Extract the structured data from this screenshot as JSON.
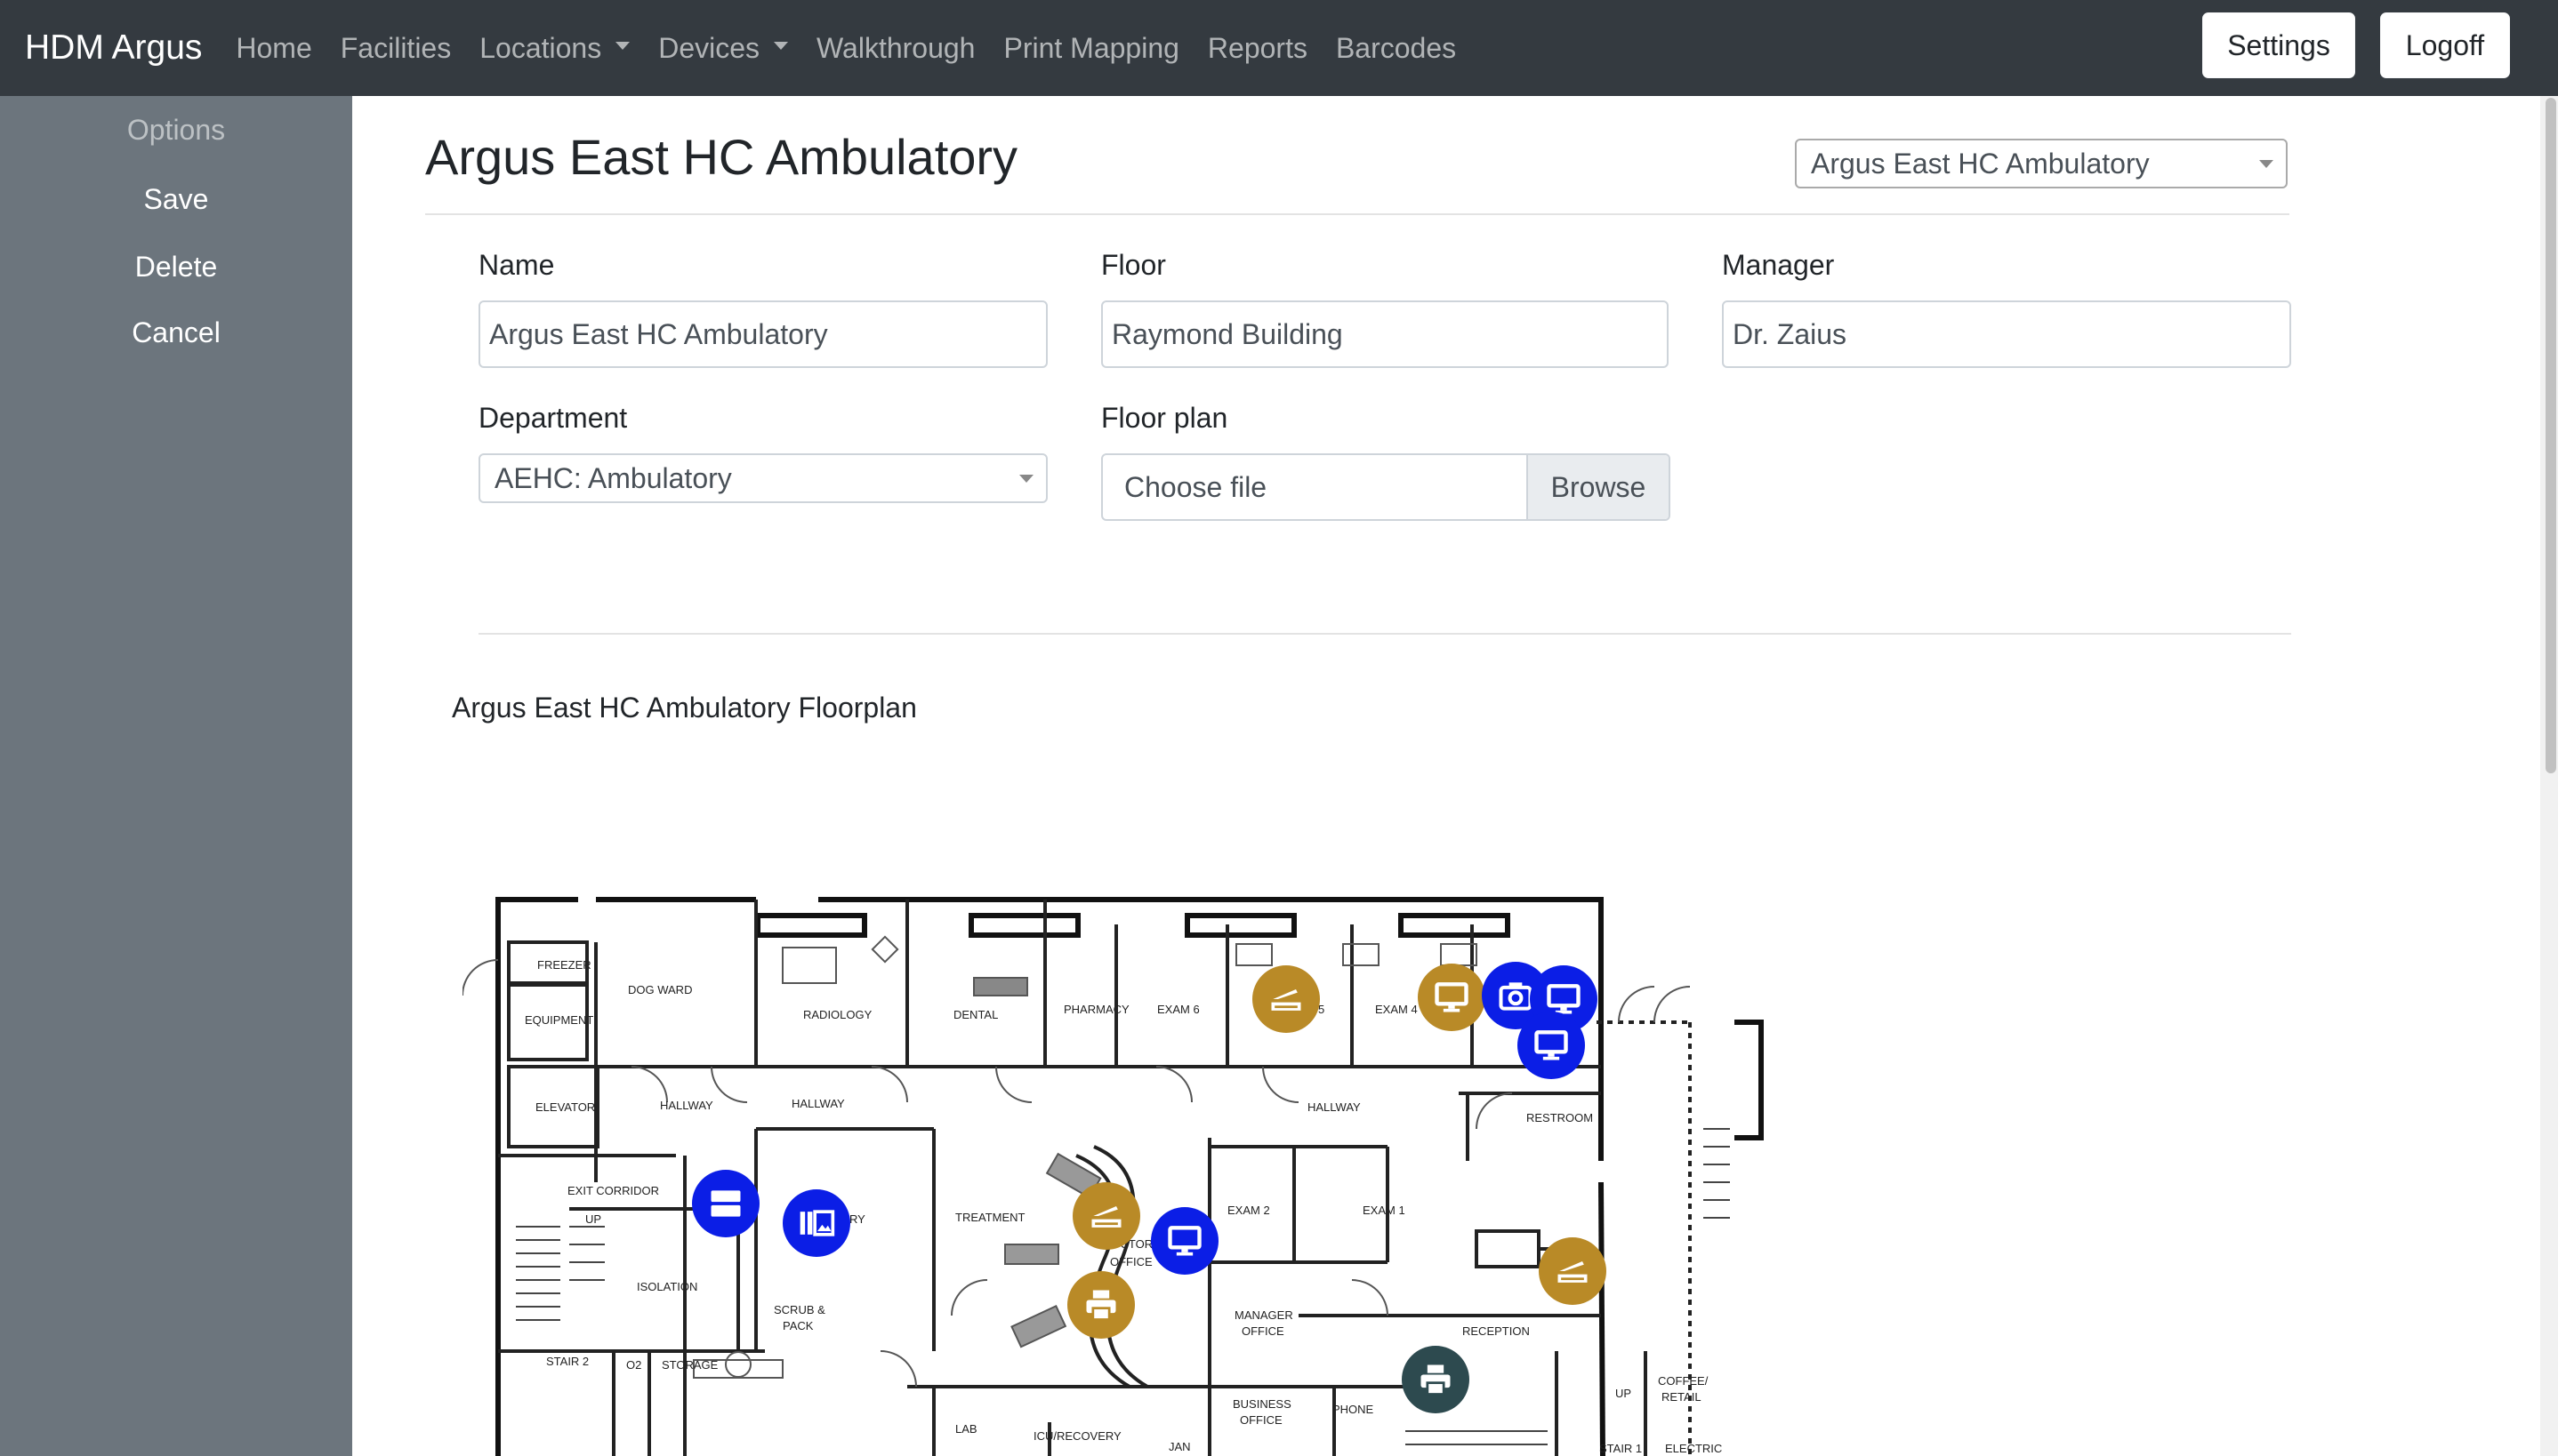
{
  "navbar": {
    "brand": "HDM Argus",
    "items": [
      {
        "label": "Home"
      },
      {
        "label": "Facilities"
      },
      {
        "label": "Locations",
        "dropdown": true
      },
      {
        "label": "Devices",
        "dropdown": true
      },
      {
        "label": "Walkthrough"
      },
      {
        "label": "Print Mapping"
      },
      {
        "label": "Reports"
      },
      {
        "label": "Barcodes"
      }
    ],
    "settings_label": "Settings",
    "logoff_label": "Logoff"
  },
  "sidebar": {
    "heading": "Options",
    "items": [
      {
        "label": "Save"
      },
      {
        "label": "Delete"
      },
      {
        "label": "Cancel"
      }
    ]
  },
  "page": {
    "title": "Argus East HC Ambulatory",
    "location_select": "Argus East HC Ambulatory"
  },
  "form": {
    "name_label": "Name",
    "name_value": "Argus East HC Ambulatory",
    "floor_label": "Floor",
    "floor_value": "Raymond Building",
    "manager_label": "Manager",
    "manager_value": "Dr. Zaius",
    "department_label": "Department",
    "department_value": "AEHC: Ambulatory",
    "floorplan_label": "Floor plan",
    "file_placeholder": "Choose file",
    "browse_label": "Browse"
  },
  "floorplan": {
    "title": "Argus East HC Ambulatory Floorplan",
    "rooms": {
      "freezer": "FREEZER",
      "equipment": "EQUIPMENT",
      "elevator": "ELEVATOR",
      "dog_ward": "DOG WARD",
      "radiology": "RADIOLOGY",
      "dental": "DENTAL",
      "pharmacy": "PHARMACY",
      "exam6": "EXAM 6",
      "exam5": "5",
      "exam4": "EXAM 4",
      "hallway1": "HALLWAY",
      "hallway2": "HALLWAY",
      "hallway3": "HALLWAY",
      "restroom": "RESTROOM",
      "exit_corridor": "EXIT CORRIDOR",
      "up1": "UP",
      "lab_ry": "RY",
      "treatment": "TREATMENT",
      "doctors_office_1": "DOCTOR'S",
      "doctors_office_2": "OFFICE",
      "exam2": "EXAM 2",
      "exam1": "EXAM 1",
      "isolation": "ISOLATION",
      "scrub_1": "SCRUB &",
      "scrub_2": "PACK",
      "manager_office_1": "MANAGER",
      "manager_office_2": "OFFICE",
      "reception": "RECEPTION",
      "stair2": "STAIR 2",
      "o2": "O2",
      "storage": "STORAGE",
      "business_1": "BUSINESS",
      "business_2": "OFFICE",
      "phone": "PHONE",
      "up2": "UP",
      "coffee_1": "COFFEE/",
      "coffee_2": "RETAIL",
      "lab": "LAB",
      "icu": "ICU/RECOVERY",
      "jan": "JAN",
      "stair1": "STAIR 1",
      "electric": "ELECTRIC"
    },
    "devices": [
      {
        "name": "scanner-device-exam6",
        "icon": "scanner-icon",
        "color": "#b98a27"
      },
      {
        "name": "monitor-device-exam4",
        "icon": "monitor-icon",
        "color": "#b98a27"
      },
      {
        "name": "camera-device-exam4",
        "icon": "camera-icon",
        "color": "#0b1ee6"
      },
      {
        "name": "monitor-device-exam4-b",
        "icon": "monitor-icon",
        "color": "#0b1ee6"
      },
      {
        "name": "monitor-device-restroom",
        "icon": "monitor-icon",
        "color": "#0b1ee6"
      },
      {
        "name": "server-device-corridor",
        "icon": "server-icon",
        "color": "#0b1ee6"
      },
      {
        "name": "gallery-device-lab",
        "icon": "gallery-icon",
        "color": "#0b1ee6"
      },
      {
        "name": "scanner-device-treatment",
        "icon": "scanner-icon",
        "color": "#b98a27"
      },
      {
        "name": "monitor-device-doctors-office",
        "icon": "monitor-icon",
        "color": "#0b1ee6"
      },
      {
        "name": "printer-device-treatment",
        "icon": "printer-icon",
        "color": "#b98a27"
      },
      {
        "name": "scanner-device-reception",
        "icon": "scanner-icon",
        "color": "#b98a27"
      },
      {
        "name": "printer-device-phone",
        "icon": "printer-icon",
        "color": "#2d4a4f"
      }
    ]
  }
}
